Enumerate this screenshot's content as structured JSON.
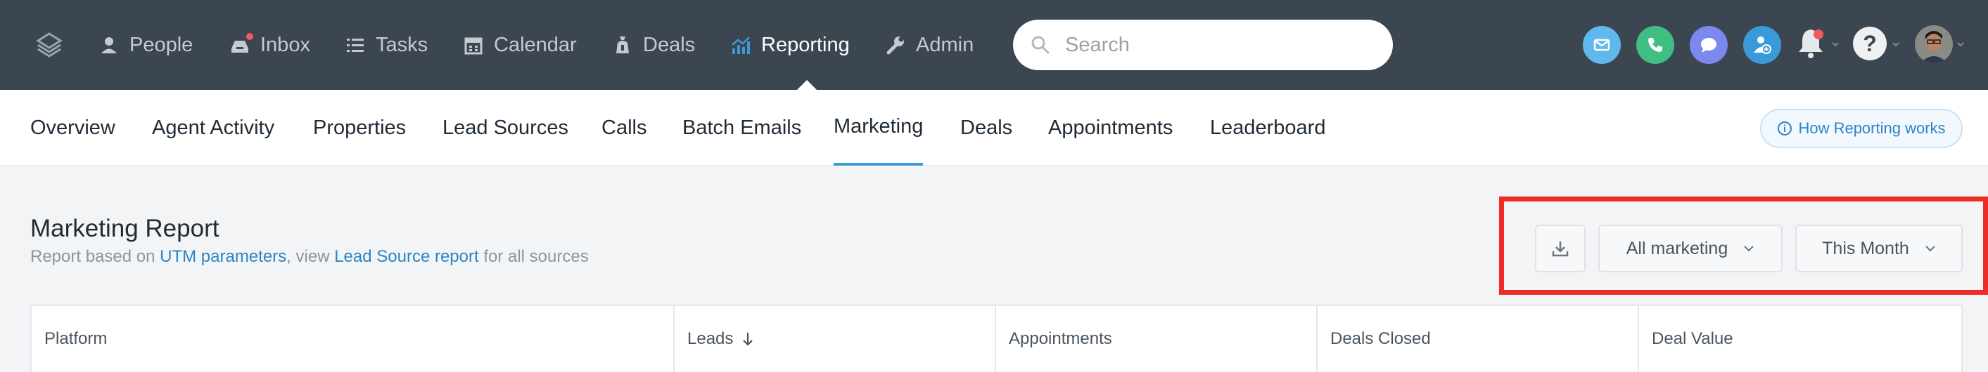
{
  "nav": {
    "items": [
      {
        "label": "People",
        "icon": "people-icon"
      },
      {
        "label": "Inbox",
        "icon": "inbox-icon"
      },
      {
        "label": "Tasks",
        "icon": "tasks-icon"
      },
      {
        "label": "Calendar",
        "icon": "calendar-icon"
      },
      {
        "label": "Deals",
        "icon": "deals-icon"
      },
      {
        "label": "Reporting",
        "icon": "reporting-icon",
        "active": true
      },
      {
        "label": "Admin",
        "icon": "admin-icon"
      }
    ],
    "search_placeholder": "Search",
    "action_icons": [
      "email-icon",
      "phone-icon",
      "chat-icon",
      "add-contact-icon",
      "bell-icon",
      "help-icon",
      "avatar"
    ]
  },
  "subnav": {
    "tabs": [
      "Overview",
      "Agent Activity",
      "Properties",
      "Lead Sources",
      "Calls",
      "Batch Emails",
      "Marketing",
      "Deals",
      "Appointments",
      "Leaderboard"
    ],
    "active_tab": "Marketing",
    "help_link": "How Reporting works"
  },
  "report": {
    "title": "Marketing Report",
    "subtitle_prefix": "Report based on ",
    "subtitle_link1": "UTM parameters",
    "subtitle_mid": ", view ",
    "subtitle_link2": "Lead Source report",
    "subtitle_suffix": " for all sources",
    "filter_source": "All marketing",
    "filter_period": "This Month"
  },
  "table": {
    "columns": [
      "Platform",
      "Leads",
      "Appointments",
      "Deals Closed",
      "Deal Value"
    ],
    "sorted_column": "Leads"
  },
  "colors": {
    "topbar": "#3b4650",
    "accent": "#3b9bd6",
    "highlight": "#ee2b24",
    "email": "#5fb9ec",
    "phone": "#3fbf83",
    "chat": "#7b88ee",
    "add_contact": "#3a9ad9"
  }
}
